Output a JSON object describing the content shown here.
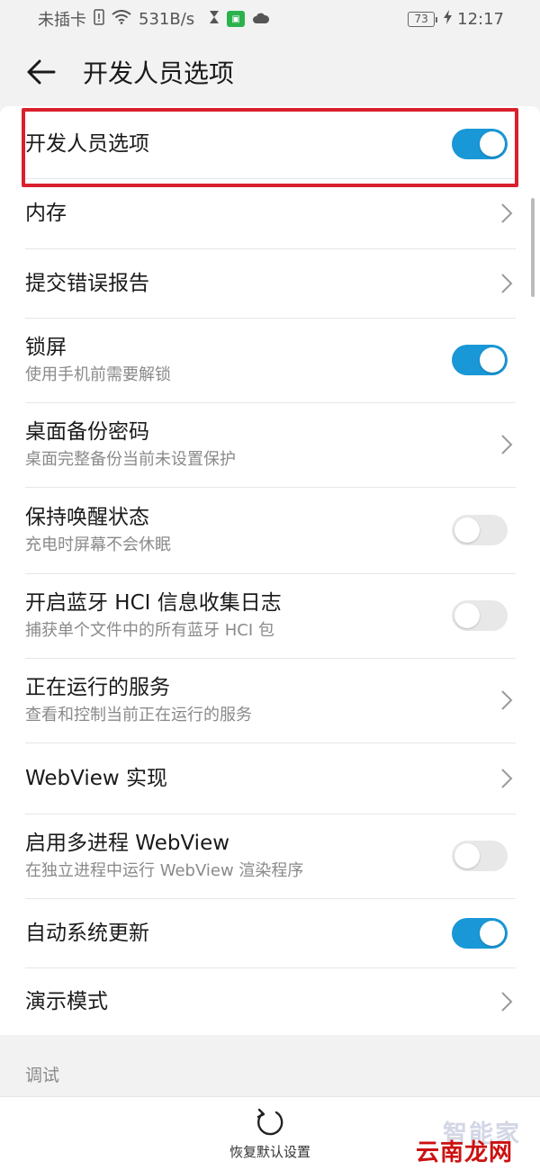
{
  "status_bar": {
    "carrier": "未插卡",
    "speed": "531B/s",
    "battery": "73",
    "time": "12:17",
    "app_badge": "iQIYI"
  },
  "header": {
    "title": "开发人员选项"
  },
  "rows": [
    {
      "label": "开发人员选项",
      "sub": "",
      "control": "toggle",
      "on": true
    },
    {
      "label": "内存",
      "sub": "",
      "control": "chevron"
    },
    {
      "label": "提交错误报告",
      "sub": "",
      "control": "chevron"
    },
    {
      "label": "锁屏",
      "sub": "使用手机前需要解锁",
      "control": "toggle",
      "on": true
    },
    {
      "label": "桌面备份密码",
      "sub": "桌面完整备份当前未设置保护",
      "control": "chevron"
    },
    {
      "label": "保持唤醒状态",
      "sub": "充电时屏幕不会休眠",
      "control": "toggle",
      "on": false
    },
    {
      "label": "开启蓝牙 HCI 信息收集日志",
      "sub": "捕获单个文件中的所有蓝牙 HCI 包",
      "control": "toggle",
      "on": false
    },
    {
      "label": "正在运行的服务",
      "sub": "查看和控制当前正在运行的服务",
      "control": "chevron"
    },
    {
      "label": "WebView 实现",
      "sub": "",
      "control": "chevron"
    },
    {
      "label": "启用多进程 WebView",
      "sub": "在独立进程中运行 WebView 渲染程序",
      "control": "toggle",
      "on": false
    },
    {
      "label": "自动系统更新",
      "sub": "",
      "control": "toggle",
      "on": true
    },
    {
      "label": "演示模式",
      "sub": "",
      "control": "chevron"
    }
  ],
  "section": {
    "debug_header": "调试"
  },
  "bottom": {
    "restore_label": "恢复默认设置"
  },
  "watermark": {
    "top": "智能家",
    "bottom": "云南龙网"
  },
  "colors": {
    "accent": "#1997d6",
    "highlight": "#d9212e",
    "background": "#f2f2f2"
  }
}
